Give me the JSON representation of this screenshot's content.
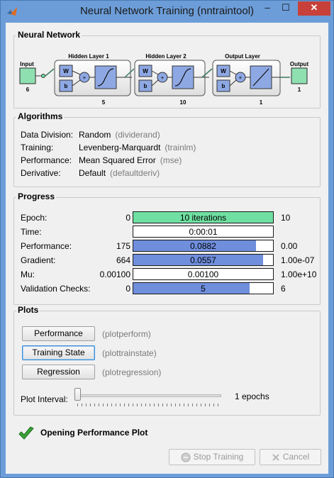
{
  "window": {
    "title": "Neural Network Training (nntraintool)",
    "minimize": "–",
    "maximize": "☐",
    "close": "✕"
  },
  "network": {
    "group_title": "Neural Network",
    "input_label": "Input",
    "input_size": "6",
    "layers": [
      {
        "title": "Hidden Layer 1",
        "size": "5"
      },
      {
        "title": "Hidden Layer 2",
        "size": "10"
      },
      {
        "title": "Output Layer",
        "size": "1"
      }
    ],
    "w_label": "W",
    "b_label": "b",
    "plus_label": "+",
    "output_label": "Output",
    "output_size": "1"
  },
  "algorithms": {
    "group_title": "Algorithms",
    "rows": [
      {
        "label": "Data Division:",
        "value": "Random",
        "code": "(dividerand)"
      },
      {
        "label": "Training:",
        "value": "Levenberg-Marquardt",
        "code": "(trainlm)"
      },
      {
        "label": "Performance:",
        "value": "Mean Squared Error",
        "code": "(mse)"
      },
      {
        "label": "Derivative:",
        "value": "Default",
        "code": "(defaultderiv)"
      }
    ]
  },
  "progress": {
    "group_title": "Progress",
    "rows": [
      {
        "label": "Epoch:",
        "start": "0",
        "current": "10 iterations",
        "end": "10",
        "fill": 1.0
      },
      {
        "label": "Time:",
        "start": "",
        "current": "0:00:01",
        "end": "",
        "fill": 0
      },
      {
        "label": "Performance:",
        "start": "175",
        "current": "0.0882",
        "end": "0.00",
        "fill": 0.88
      },
      {
        "label": "Gradient:",
        "start": "664",
        "current": "0.0557",
        "end": "1.00e-07",
        "fill": 0.93
      },
      {
        "label": "Mu:",
        "start": "0.00100",
        "current": "0.00100",
        "end": "1.00e+10",
        "fill": 0
      },
      {
        "label": "Validation Checks:",
        "start": "0",
        "current": "5",
        "end": "6",
        "fill": 0.83
      }
    ]
  },
  "plots": {
    "group_title": "Plots",
    "buttons": [
      {
        "label": "Performance",
        "code": "(plotperform)"
      },
      {
        "label": "Training State",
        "code": "(plottrainstate)"
      },
      {
        "label": "Regression",
        "code": "(plotregression)"
      }
    ],
    "interval_label": "Plot Interval:",
    "interval_value": "1 epochs",
    "interval_position": 0
  },
  "status": {
    "text": "Opening Performance Plot"
  },
  "actions": {
    "stop_label": "Stop Training",
    "cancel_label": "Cancel"
  },
  "colors": {
    "accent_green": "#6fe0a2",
    "progress_blue": "#6f8edc",
    "close_red": "#c7413a"
  }
}
